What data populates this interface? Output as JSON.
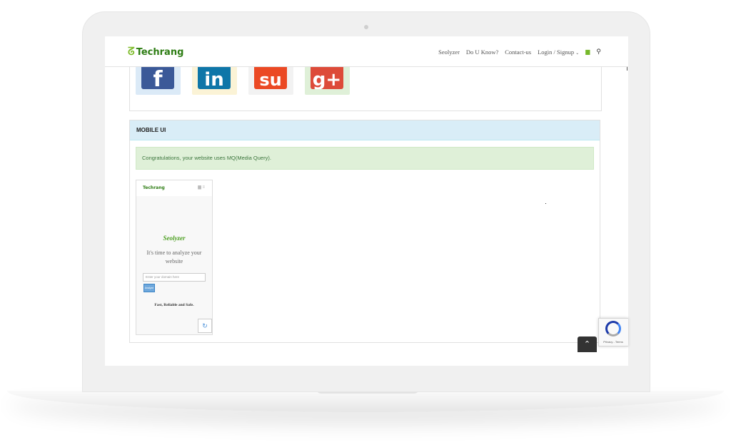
{
  "header": {
    "logo_text": "Techrang",
    "nav": [
      {
        "label": "Seolyzer"
      },
      {
        "label": "Do U Know?"
      },
      {
        "label": "Contact-us"
      },
      {
        "label": "Login / Signup"
      }
    ],
    "cart_icon": "cart-icon",
    "search_icon": "search-icon"
  },
  "social": [
    {
      "name": "facebook",
      "glyph": "f",
      "bg": "#dbeaf7",
      "icon_color": "#3b5998"
    },
    {
      "name": "linkedin",
      "glyph": "in",
      "bg": "#fbf3d6",
      "icon_color": "#0e76a8"
    },
    {
      "name": "stumbleupon",
      "glyph": "su",
      "bg": "#f2f2f2",
      "icon_color": "#eb4924"
    },
    {
      "name": "googleplus",
      "glyph": "g+",
      "bg": "#dff0d8",
      "icon_color": "#dd4b39"
    }
  ],
  "mobile_panel": {
    "title": "MOBILE UI",
    "alert": "Congratulations, your website uses MQ(Media Query)."
  },
  "phone_preview": {
    "logo": "Techrang",
    "title": "Seolyzer",
    "subtitle": "It's time to analyze your website",
    "input_placeholder": "Enter your domain here",
    "button": "Analyze",
    "tagline": "Fast, Reliable and Safe."
  },
  "recaptcha": {
    "label": "Privacy - Terms"
  },
  "colors": {
    "brand_green": "#2e7d14",
    "panel_head": "#d9edf7",
    "alert_bg": "#dff0d8",
    "alert_text": "#3c763d"
  }
}
